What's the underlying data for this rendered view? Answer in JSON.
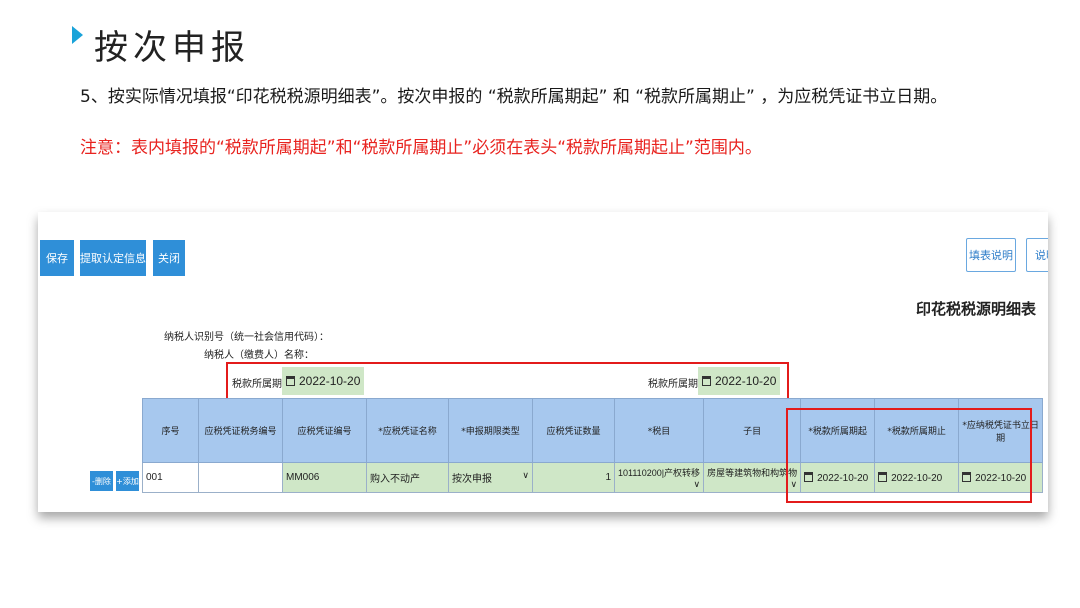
{
  "slide": {
    "title": "按次申报",
    "paragraph": "5、按实际情况填报“印花税税源明细表”。按次申报的 “税款所属期起” 和 “税款所属期止” ，为应税凭证书立日期。",
    "note": "注意：表内填报的“税款所属期起”和“税款所属期止”必须在表头“税款所属期起止”范围内。"
  },
  "toolbar": {
    "save": "保存",
    "extract": "提取认定信息",
    "close": "关闭",
    "fill_help": "填表说明",
    "help": "说明"
  },
  "form": {
    "title": "印花税税源明细表",
    "taxpayer_id_label": "纳税人识别号（统一社会信用代码）：",
    "taxpayer_name_label": "纳税人（缴费人）名称：",
    "period_start_label": "税款所属期起：",
    "period_start": "2022-10-20",
    "period_end_label": "税款所属期止：",
    "period_end": "2022-10-20"
  },
  "table": {
    "headers": [
      "序号",
      "应税凭证税务编号",
      "应税凭证编号",
      "*应税凭证名称",
      "*申报期限类型",
      "应税凭证数量",
      "*税目",
      "子目",
      "*税款所属期起",
      "*税款所属期止",
      "*应纳税凭证书立日期"
    ],
    "row_actions": {
      "delete": "-删除",
      "add": "+添加"
    },
    "rows": [
      {
        "seq": "001",
        "tax_no": "",
        "voucher_no": "MM006",
        "voucher_name": "购入不动产",
        "period_type": "按次申报",
        "quantity": "1",
        "tax_item": "101110200|产权转移",
        "sub_item": "房屋等建筑物和构筑物",
        "start": "2022-10-20",
        "end": "2022-10-20",
        "sign_date": "2022-10-20"
      }
    ]
  },
  "colors": {
    "accent": "#2f8fd8",
    "highlight": "#e31b1b",
    "header_bg": "#a7c8ee",
    "field_bg": "#cfe7c7"
  }
}
